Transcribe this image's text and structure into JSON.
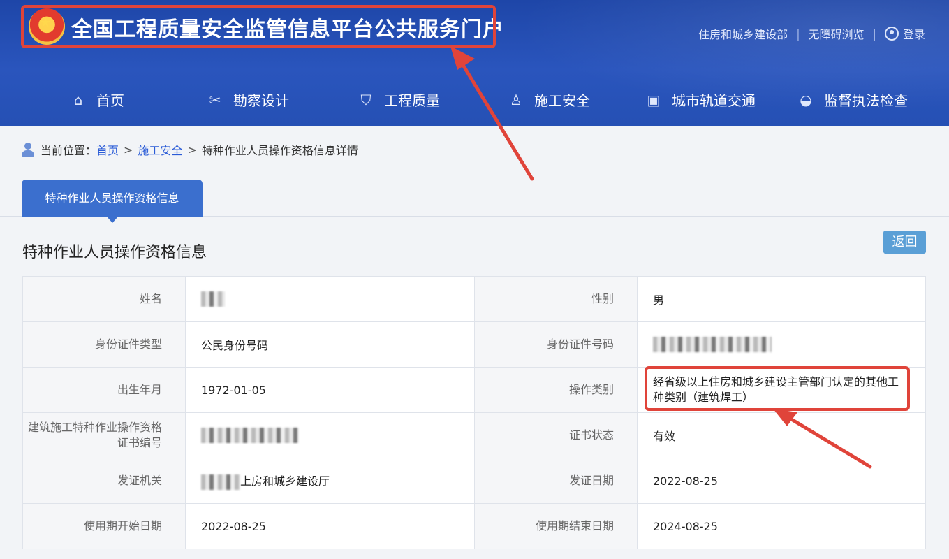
{
  "header": {
    "site_title": "全国工程质量安全监管信息平台公共服务门户",
    "links": [
      "住房和城乡建设部",
      "无障碍浏览"
    ],
    "login_label": "登录"
  },
  "nav": [
    {
      "label": "首页",
      "icon": "home-icon"
    },
    {
      "label": "勘察设计",
      "icon": "tools-icon"
    },
    {
      "label": "工程质量",
      "icon": "shield-icon"
    },
    {
      "label": "施工安全",
      "icon": "worker-icon"
    },
    {
      "label": "城市轨道交通",
      "icon": "train-icon"
    },
    {
      "label": "监督执法检查",
      "icon": "police-cap-icon"
    }
  ],
  "breadcrumb": {
    "prefix": "当前位置：",
    "items": [
      "首页",
      "施工安全",
      "特种作业人员操作资格信息详情"
    ]
  },
  "tab_label": "特种作业人员操作资格信息",
  "section_title": "特种作业人员操作资格信息",
  "back_label": "返回",
  "rows": [
    {
      "l1": "姓名",
      "v1": "",
      "l2": "性别",
      "v2": "男"
    },
    {
      "l1": "身份证件类型",
      "v1": "公民身份号码",
      "l2": "身份证件号码",
      "v2": ""
    },
    {
      "l1": "出生年月",
      "v1": "1972-01-05",
      "l2": "操作类别",
      "v2": "经省级以上住房和城乡建设主管部门认定的其他工种类别（建筑焊工）"
    },
    {
      "l1": "建筑施工特种作业操作资格证书编号",
      "v1": "",
      "l2": "证书状态",
      "v2": "有效"
    },
    {
      "l1": "发证机关",
      "v1": "上房和城乡建设厅",
      "l2": "发证日期",
      "v2": "2022-08-25"
    },
    {
      "l1": "使用期开始日期",
      "v1": "2022-08-25",
      "l2": "使用期结束日期",
      "v2": "2024-08-25"
    }
  ],
  "colors": {
    "header_blue": "#2550b4",
    "tab_blue": "#3b6fce",
    "highlight_red": "#e0443a",
    "back_button": "#5a9fd6"
  }
}
